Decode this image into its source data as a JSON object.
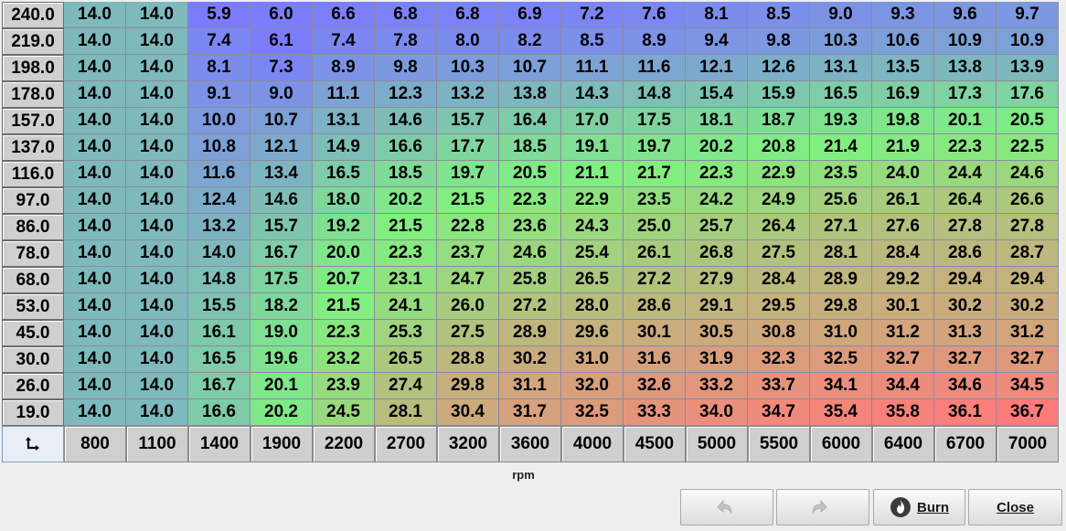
{
  "table": {
    "y_axis": [
      "240.0",
      "219.0",
      "198.0",
      "178.0",
      "157.0",
      "137.0",
      "116.0",
      "97.0",
      "86.0",
      "78.0",
      "68.0",
      "53.0",
      "45.0",
      "30.0",
      "26.0",
      "19.0"
    ],
    "x_axis": [
      "800",
      "1100",
      "1400",
      "1900",
      "2200",
      "2700",
      "3200",
      "3600",
      "4000",
      "4500",
      "5000",
      "5500",
      "6000",
      "6400",
      "6700",
      "7000"
    ],
    "rows": [
      [
        "14.0",
        "14.0",
        "5.9",
        "6.0",
        "6.6",
        "6.8",
        "6.8",
        "6.9",
        "7.2",
        "7.6",
        "8.1",
        "8.5",
        "9.0",
        "9.3",
        "9.6",
        "9.7"
      ],
      [
        "14.0",
        "14.0",
        "7.4",
        "6.1",
        "7.4",
        "7.8",
        "8.0",
        "8.2",
        "8.5",
        "8.9",
        "9.4",
        "9.8",
        "10.3",
        "10.6",
        "10.9",
        "10.9"
      ],
      [
        "14.0",
        "14.0",
        "8.1",
        "7.3",
        "8.9",
        "9.8",
        "10.3",
        "10.7",
        "11.1",
        "11.6",
        "12.1",
        "12.6",
        "13.1",
        "13.5",
        "13.8",
        "13.9"
      ],
      [
        "14.0",
        "14.0",
        "9.1",
        "9.0",
        "11.1",
        "12.3",
        "13.2",
        "13.8",
        "14.3",
        "14.8",
        "15.4",
        "15.9",
        "16.5",
        "16.9",
        "17.3",
        "17.6"
      ],
      [
        "14.0",
        "14.0",
        "10.0",
        "10.7",
        "13.1",
        "14.6",
        "15.7",
        "16.4",
        "17.0",
        "17.5",
        "18.1",
        "18.7",
        "19.3",
        "19.8",
        "20.1",
        "20.5"
      ],
      [
        "14.0",
        "14.0",
        "10.8",
        "12.1",
        "14.9",
        "16.6",
        "17.7",
        "18.5",
        "19.1",
        "19.7",
        "20.2",
        "20.8",
        "21.4",
        "21.9",
        "22.3",
        "22.5"
      ],
      [
        "14.0",
        "14.0",
        "11.6",
        "13.4",
        "16.5",
        "18.5",
        "19.7",
        "20.5",
        "21.1",
        "21.7",
        "22.3",
        "22.9",
        "23.5",
        "24.0",
        "24.4",
        "24.6"
      ],
      [
        "14.0",
        "14.0",
        "12.4",
        "14.6",
        "18.0",
        "20.2",
        "21.5",
        "22.3",
        "22.9",
        "23.5",
        "24.2",
        "24.9",
        "25.6",
        "26.1",
        "26.4",
        "26.6"
      ],
      [
        "14.0",
        "14.0",
        "13.2",
        "15.7",
        "19.2",
        "21.5",
        "22.8",
        "23.6",
        "24.3",
        "25.0",
        "25.7",
        "26.4",
        "27.1",
        "27.6",
        "27.8",
        "27.8"
      ],
      [
        "14.0",
        "14.0",
        "14.0",
        "16.7",
        "20.0",
        "22.3",
        "23.7",
        "24.6",
        "25.4",
        "26.1",
        "26.8",
        "27.5",
        "28.1",
        "28.4",
        "28.6",
        "28.7"
      ],
      [
        "14.0",
        "14.0",
        "14.8",
        "17.5",
        "20.7",
        "23.1",
        "24.7",
        "25.8",
        "26.5",
        "27.2",
        "27.9",
        "28.4",
        "28.9",
        "29.2",
        "29.4",
        "29.4"
      ],
      [
        "14.0",
        "14.0",
        "15.5",
        "18.2",
        "21.5",
        "24.1",
        "26.0",
        "27.2",
        "28.0",
        "28.6",
        "29.1",
        "29.5",
        "29.8",
        "30.1",
        "30.2",
        "30.2"
      ],
      [
        "14.0",
        "14.0",
        "16.1",
        "19.0",
        "22.3",
        "25.3",
        "27.5",
        "28.9",
        "29.6",
        "30.1",
        "30.5",
        "30.8",
        "31.0",
        "31.2",
        "31.3",
        "31.2"
      ],
      [
        "14.0",
        "14.0",
        "16.5",
        "19.6",
        "23.2",
        "26.5",
        "28.8",
        "30.2",
        "31.0",
        "31.6",
        "31.9",
        "32.3",
        "32.5",
        "32.7",
        "32.7",
        "32.7"
      ],
      [
        "14.0",
        "14.0",
        "16.7",
        "20.1",
        "23.9",
        "27.4",
        "29.8",
        "31.1",
        "32.0",
        "32.6",
        "33.2",
        "33.7",
        "34.1",
        "34.4",
        "34.6",
        "34.5"
      ],
      [
        "14.0",
        "14.0",
        "16.6",
        "20.2",
        "24.5",
        "28.1",
        "30.4",
        "31.7",
        "32.5",
        "33.3",
        "34.0",
        "34.7",
        "35.4",
        "35.8",
        "36.1",
        "36.7"
      ]
    ],
    "x_axis_label": "rpm",
    "corner_icon": "corner-arrow-icon"
  },
  "colors": {
    "low": "#7b7bff",
    "mid": "#80f080",
    "high": "#ff7b7b",
    "header_bg": "#cfcfcf",
    "window_bg": "#eeeeee"
  },
  "buttons": {
    "undo_icon": "undo-icon",
    "redo_icon": "redo-icon",
    "burn_icon": "flame-icon",
    "burn_label": "Burn",
    "close_label": "Close"
  }
}
